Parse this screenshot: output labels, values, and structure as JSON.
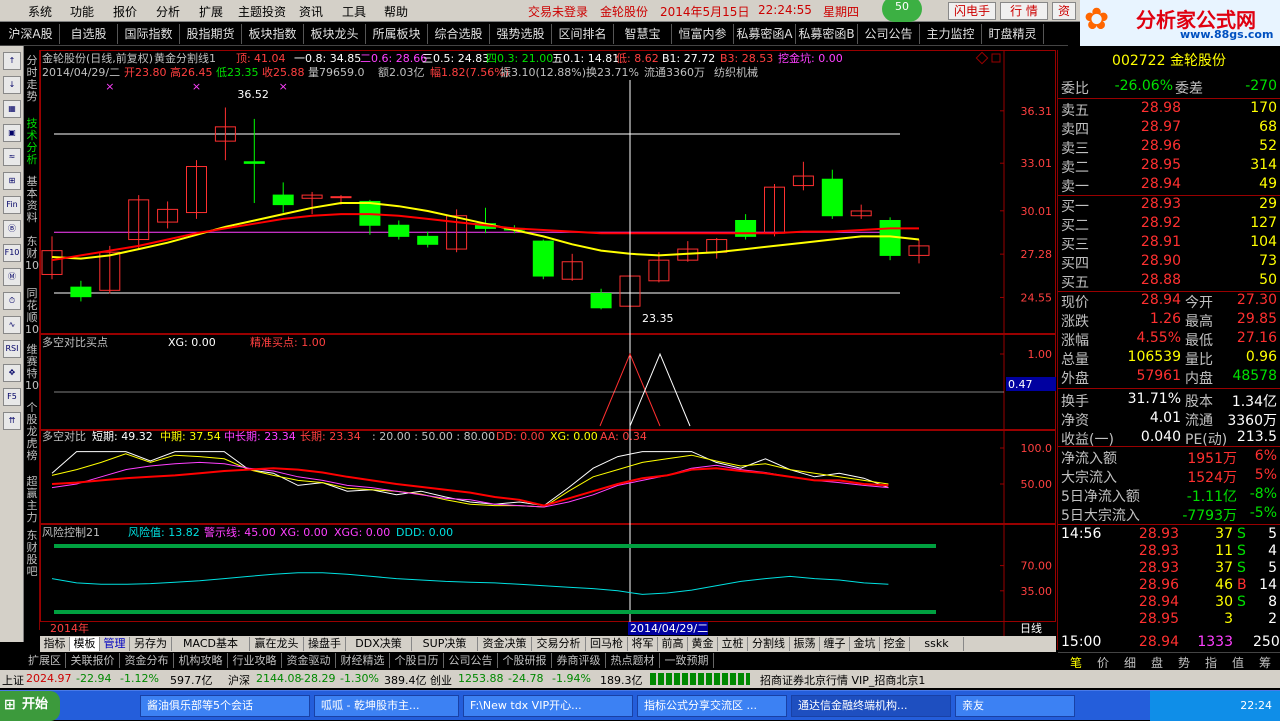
{
  "menu": {
    "items": [
      "系统",
      "功能",
      "报价",
      "分析",
      "扩展",
      "主题投资",
      "资讯",
      "工具",
      "帮助"
    ],
    "login": "交易未登录",
    "stock": "金轮股份",
    "date": "2014年5月15日",
    "time": "22:24:55",
    "weekday": "星期四",
    "count": "50",
    "flash": "闪电手",
    "quote": "行 情",
    "trade": "资",
    "logo": "分析家公式网",
    "logo_url": "www.88gs.com"
  },
  "toolbar": [
    "沪深A股",
    "自选股",
    "国际指数",
    "股指期货",
    "板块指数",
    "板块龙头",
    "所属板块",
    "综合选股",
    "强势选股",
    "区间排名",
    "智慧宝",
    "恒富内参",
    "私募密函A",
    "私募密函B",
    "公司公告",
    "主力监控",
    "盯盘精灵"
  ],
  "vtabs": [
    "分时走势",
    "技术分析",
    "基本资料",
    "东财10",
    "同花顺10",
    "维赛特10",
    "个股龙虎榜",
    "超赢主力",
    "东财股吧"
  ],
  "left_icons": [
    "↑",
    "↓",
    "▦",
    "▣",
    "≈",
    "⊞",
    "Fin",
    "Ⓑ",
    "F10",
    "Ⓜ",
    "⏱",
    "∿",
    "RSI",
    "✥",
    "F5",
    "⇈"
  ],
  "kline": {
    "title": "金轮股份(日线,前复权)",
    "formula": "黄金分割线1",
    "top_label": "顶:",
    "top_val": "41.04",
    "l1": "一0.8: 34.85",
    "l2": "二0.6: 28.66",
    "l3": "三0.5: 24.83",
    "l4": "四0.3: 21.00",
    "l5": "五0.1: 14.81",
    "low": "低: 8.62",
    "b1": "B1: 27.72",
    "b3": "B3: 28.53",
    "wjk": "挖金坑: 0.00",
    "date": "2014/04/29/二",
    "open": "开23.80",
    "high": "高26.45",
    "lowv": "低23.35",
    "close": "收25.88",
    "vol": "量79659.0",
    "amt": "额2.03亿",
    "pct": "幅1.82(7.56%)",
    "amp": "振3.10(12.88%)",
    "turn": "换23.71%",
    "float": "流通3360万",
    "ind": "纺织机械",
    "hi_mark": "36.52",
    "lo_mark": "23.35",
    "axis": [
      "36.31",
      "33.01",
      "30.01",
      "27.28",
      "24.55"
    ]
  },
  "p2": {
    "title": "多空对比买点",
    "xg": "XG: 0.00",
    "jz": "精准买点: 1.00",
    "axis": [
      "1.00",
      "0.47"
    ]
  },
  "p3": {
    "title": "多空对比",
    "short": "短期: 49.32",
    "mid": "中期: 37.54",
    "midlong": "中长期: 23.34",
    "long": "长期: 23.34",
    "lv": ": 20.00 : 50.00 : 80.00",
    "dd": "DD: 0.00",
    "xg": "XG: 0.00",
    "aa": "AA: 0.34",
    "axis": [
      "100.0",
      "50.00"
    ]
  },
  "p4": {
    "title": "风险控制21",
    "risk": "风险值: 13.82",
    "warn": "警示线: 45.00",
    "xg": "XG: 0.00",
    "xgg": "XGG: 0.00",
    "ddd": "DDD: 0.00",
    "axis": [
      "70.00",
      "35.00"
    ]
  },
  "xaxis": {
    "year": "2014年",
    "cursor": "2014/04/29/二",
    "period": "日线"
  },
  "btabs": [
    "指标",
    "模板",
    "管理",
    "另存为",
    "MACD基本",
    "赢在龙头",
    "操盘手",
    "DDX决策",
    "SUP决策",
    "资金决策",
    "交易分析",
    "回马枪",
    "将军",
    "前高",
    "黄金",
    "立桩",
    "分割线",
    "振荡",
    "缠子",
    "金坑",
    "挖金",
    "sskk"
  ],
  "ftabs": [
    "扩展区",
    "关联报价",
    "资金分布",
    "机构攻略",
    "行业攻略",
    "资金驱动",
    "财经精选",
    "个股日历",
    "公司公告",
    "个股研报",
    "券商评级",
    "热点题材",
    "一致预期"
  ],
  "quote": {
    "code": "002722",
    "name": "金轮股份",
    "wb_label": "委比",
    "wb": "-26.06%",
    "wc_label": "委差",
    "wc": "-270",
    "asks": [
      {
        "l": "卖五",
        "p": "28.98",
        "v": "170"
      },
      {
        "l": "卖四",
        "p": "28.97",
        "v": "68"
      },
      {
        "l": "卖三",
        "p": "28.96",
        "v": "52"
      },
      {
        "l": "卖二",
        "p": "28.95",
        "v": "314"
      },
      {
        "l": "卖一",
        "p": "28.94",
        "v": "49"
      }
    ],
    "bids": [
      {
        "l": "买一",
        "p": "28.93",
        "v": "29"
      },
      {
        "l": "买二",
        "p": "28.92",
        "v": "127"
      },
      {
        "l": "买三",
        "p": "28.91",
        "v": "104"
      },
      {
        "l": "买四",
        "p": "28.90",
        "v": "73"
      },
      {
        "l": "买五",
        "p": "28.88",
        "v": "50"
      }
    ],
    "stats": [
      [
        "现价",
        "28.94",
        "今开",
        "27.30"
      ],
      [
        "涨跌",
        "1.26",
        "最高",
        "29.85"
      ],
      [
        "涨幅",
        "4.55%",
        "最低",
        "27.16"
      ],
      [
        "总量",
        "106539",
        "量比",
        "0.96"
      ],
      [
        "外盘",
        "57961",
        "内盘",
        "48578"
      ],
      [
        "换手",
        "31.71%",
        "股本",
        "1.34亿"
      ],
      [
        "净资",
        "4.01",
        "流通",
        "3360万"
      ],
      [
        "收益(一)",
        "0.040",
        "PE(动)",
        "213.5"
      ]
    ],
    "flows": [
      [
        "净流入额",
        "1951万",
        "6%"
      ],
      [
        "大宗流入",
        "1524万",
        "5%"
      ],
      [
        "5日净流入额",
        "-1.11亿",
        "-8%"
      ],
      [
        "5日大宗流入",
        "-7793万",
        "-5%"
      ]
    ],
    "ticks": [
      [
        "14:56",
        "28.93",
        "37",
        "S",
        "5"
      ],
      [
        "",
        "28.93",
        "11",
        "S",
        "4"
      ],
      [
        "",
        "28.93",
        "37",
        "S",
        "5"
      ],
      [
        "",
        "28.96",
        "46",
        "B",
        "14"
      ],
      [
        "",
        "28.94",
        "30",
        "S",
        "8"
      ],
      [
        "",
        "28.95",
        "3",
        "",
        "2"
      ],
      [
        "15:00",
        "28.94",
        "1333",
        "",
        "250"
      ]
    ],
    "tabs": [
      "笔",
      "价",
      "细",
      "盘",
      "势",
      "指",
      "值",
      "筹"
    ]
  },
  "status": {
    "sh_label": "上证",
    "sh": "2024.97",
    "sh_chg": "-22.94",
    "sh_pct": "-1.12%",
    "sh_amt": "597.7亿",
    "sz_label": "沪深",
    "sz": "2144.08",
    "sz_chg": "-28.29",
    "sz_pct": "-1.30%",
    "sz_amt": "389.4亿",
    "cy_label": "创业",
    "cy": "1253.88",
    "cy_chg": "-24.78",
    "cy_pct": "-1.94%",
    "cy_amt": "189.3亿",
    "broker": "招商证券北京行情 VIP_招商北京1"
  },
  "taskbar": {
    "start": "开始",
    "items": [
      "酱油俱乐部等5个会话",
      "呱呱 - 乾坤股市主...",
      "F:\\New tdx VIP开心...",
      "指标公式分享交流区 ...",
      "通达信金融终端机构...",
      "亲友"
    ],
    "clock": "22:24"
  },
  "chart_data": {
    "type": "candlestick",
    "ylim": [
      22.5,
      38.0
    ],
    "candles": [
      [
        26.0,
        27.5,
        28.4,
        25.7
      ],
      [
        25.2,
        24.6,
        25.6,
        24.3
      ],
      [
        25.0,
        27.4,
        27.8,
        24.8
      ],
      [
        28.2,
        30.7,
        31.0,
        27.6
      ],
      [
        29.3,
        30.1,
        30.6,
        28.9
      ],
      [
        29.9,
        32.8,
        33.2,
        29.5
      ],
      [
        34.4,
        35.3,
        36.52,
        33.2
      ],
      [
        33.1,
        33.0,
        35.8,
        30.5
      ],
      [
        31.0,
        30.4,
        31.8,
        29.9
      ],
      [
        30.8,
        31.0,
        31.2,
        29.8
      ],
      [
        30.9,
        30.9,
        31.0,
        30.4
      ],
      [
        30.6,
        29.1,
        30.7,
        28.5
      ],
      [
        29.1,
        28.4,
        29.4,
        28.2
      ],
      [
        28.4,
        27.9,
        28.7,
        27.7
      ],
      [
        27.6,
        29.7,
        30.1,
        27.4
      ],
      [
        29.2,
        28.9,
        30.2,
        28.6
      ],
      [
        28.9,
        28.8,
        29.1,
        28.6
      ],
      [
        28.1,
        25.9,
        28.2,
        25.7
      ],
      [
        25.7,
        26.8,
        27.3,
        25.6
      ],
      [
        24.8,
        23.9,
        25.1,
        23.8
      ],
      [
        24.0,
        25.9,
        26.45,
        23.35
      ],
      [
        25.6,
        26.9,
        27.4,
        25.5
      ],
      [
        26.9,
        27.6,
        28.1,
        26.8
      ],
      [
        27.4,
        28.2,
        28.3,
        27.0
      ],
      [
        29.4,
        28.4,
        29.8,
        28.2
      ],
      [
        28.6,
        31.5,
        31.7,
        28.4
      ],
      [
        31.6,
        32.2,
        33.1,
        31.3
      ],
      [
        32.0,
        29.7,
        32.6,
        29.5
      ],
      [
        29.7,
        30.0,
        30.4,
        29.5
      ],
      [
        29.4,
        27.2,
        29.6,
        26.9
      ],
      [
        27.2,
        27.8,
        28.2,
        26.7
      ]
    ],
    "ma_yellow": [
      27.1,
      27.0,
      27.2,
      27.6,
      28.0,
      28.5,
      29.0,
      29.4,
      29.8,
      30.2,
      30.5,
      30.5,
      30.3,
      30.0,
      29.6,
      29.2,
      28.8,
      28.4,
      27.9,
      27.5,
      27.3,
      27.2,
      27.3,
      27.4,
      27.6,
      27.8,
      28.0,
      28.2,
      28.4,
      28.4,
      28.2
    ],
    "ma_red": [
      26.9,
      27.2,
      27.5,
      27.8,
      28.2,
      28.6,
      28.9,
      29.2,
      29.5,
      29.7,
      29.8,
      29.8,
      29.7,
      29.5,
      29.3,
      29.1,
      28.9,
      28.8,
      28.7,
      28.6,
      28.6,
      28.6,
      28.6,
      28.6,
      28.6,
      28.6,
      28.7,
      28.7,
      28.8,
      28.9,
      28.9
    ],
    "hlines": [
      34.85,
      28.66,
      24.83
    ],
    "kdj_short": [
      65,
      95,
      95,
      95,
      82,
      95,
      95,
      95,
      70,
      65,
      48,
      52,
      40,
      42,
      35,
      40,
      32,
      25,
      22,
      25,
      20,
      45,
      72,
      88,
      95,
      95,
      95,
      80,
      72,
      85,
      70,
      60,
      65,
      58,
      45
    ],
    "kdj_mid": [
      62,
      70,
      80,
      92,
      80,
      90,
      88,
      85,
      70,
      62,
      55,
      52,
      44,
      42,
      40,
      36,
      28,
      22,
      20,
      20,
      18,
      40,
      60,
      70,
      80,
      85,
      90,
      82,
      75,
      78,
      70,
      65,
      60,
      55,
      50
    ],
    "kdj_mlong": [
      45,
      50,
      60,
      70,
      75,
      78,
      80,
      78,
      72,
      68,
      60,
      55,
      48,
      45,
      40,
      35,
      30,
      28,
      22,
      20,
      18,
      25,
      35,
      48,
      55,
      62,
      72,
      76,
      70,
      66,
      60,
      55,
      52,
      48,
      45
    ],
    "kdj_long": [
      50,
      52,
      55,
      58,
      60,
      62,
      65,
      68,
      70,
      72,
      70,
      66,
      60,
      55,
      50,
      46,
      42,
      38,
      32,
      28,
      20,
      30,
      40,
      50,
      58,
      62,
      70,
      72,
      68,
      65,
      60,
      55,
      55,
      50,
      48
    ],
    "risk": [
      52,
      46,
      44,
      44,
      45,
      47,
      49,
      52,
      55,
      58,
      60,
      60,
      58,
      55,
      52,
      50,
      48,
      47,
      46,
      44,
      42,
      40,
      38,
      35,
      30,
      32,
      36,
      42,
      48,
      52,
      55,
      52,
      50,
      46,
      44
    ]
  }
}
